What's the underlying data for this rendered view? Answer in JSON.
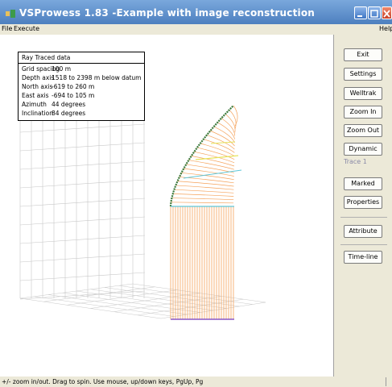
{
  "window": {
    "title": "VSProwess 1.83  -Example with image reconstruction",
    "colors": {
      "titlebar": "#4d7fbf",
      "panel": "#ece9d8",
      "wavefront": "#f5a25a",
      "trace": "#3c7a3c"
    }
  },
  "menu": {
    "file": "File",
    "execute": "Execute",
    "help": "Help"
  },
  "info_box": {
    "title": "Ray Traced data",
    "rows": [
      {
        "key": "Grid spacing",
        "value": "100 m"
      },
      {
        "key": "Depth axis",
        "value": "1518 to 2398 m below datum"
      },
      {
        "key": "North axis",
        "value": "-619 to 260 m"
      },
      {
        "key": "East axis",
        "value": "-694 to 105 m"
      },
      {
        "key": "Azimuth",
        "value": "44 degrees"
      },
      {
        "key": "Inclination",
        "value": "84 degrees"
      }
    ]
  },
  "buttons": {
    "exit": "Exit",
    "settings": "Settings",
    "welltrak": "Welltrak",
    "zoom_in": "Zoom In",
    "zoom_out": "Zoom Out",
    "dynamic": "Dynamic",
    "trace_label": "Trace 1",
    "marked": "Marked",
    "properties": "Properties",
    "attribute": "Attribute",
    "time_line": "Time-line"
  },
  "status": "+/- zoom in/out. Drag to spin. Use mouse, up/down keys, PgUp, Pg",
  "icons": [
    "app-icon",
    "minimize-icon",
    "maximize-icon",
    "close-icon"
  ]
}
